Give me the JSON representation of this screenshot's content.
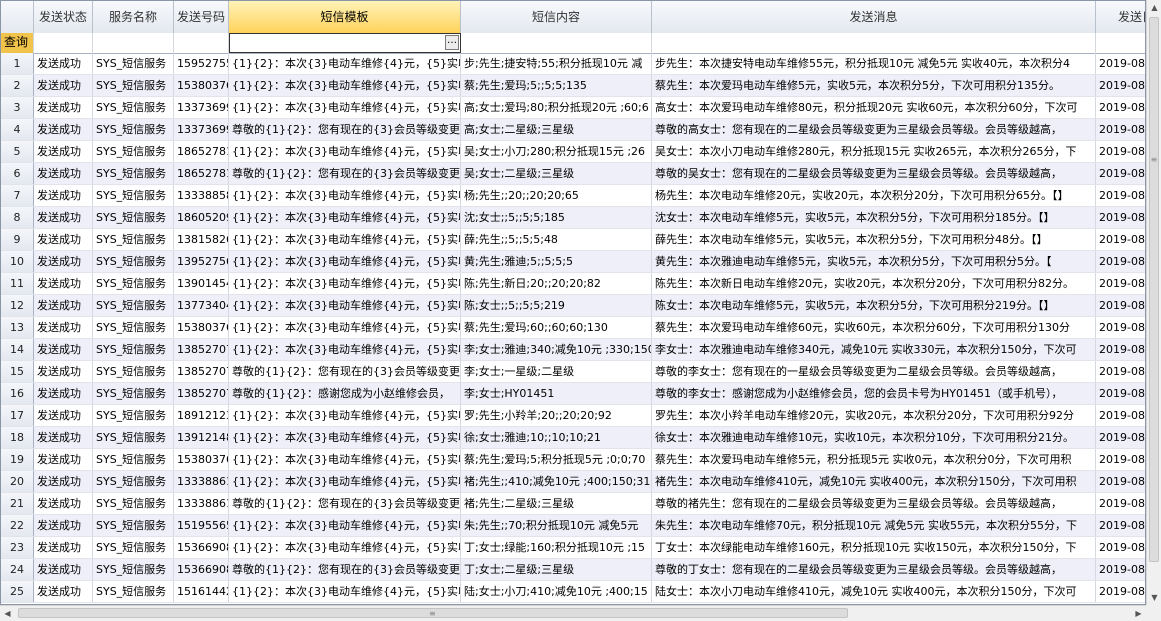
{
  "columns": [
    "发送状态",
    "服务名称",
    "发送号码",
    "短信模板",
    "短信内容",
    "发送消息",
    "发送日"
  ],
  "filter": {
    "indicator_label": "查询",
    "editor_value": "",
    "ellipsis": "…"
  },
  "scroll": {
    "vertical_arrow_up": "▲",
    "vertical_arrow_down": "▼",
    "horizontal_arrow_left": "◀",
    "horizontal_arrow_right": "▶",
    "grip": "≡"
  },
  "rows": [
    {
      "n": "1",
      "status": "发送成功",
      "service": "SYS_短信服务",
      "phone": "15952755",
      "template": "{1}{2}：本次{3}电动车维修{4}元，{5}实收{",
      "content": "步;先生;捷安特;55;积分抵现10元 减",
      "message": "步先生：本次捷安特电动车维修55元，积分抵现10元 减免5元 实收40元，本次积分4",
      "date": "2019-08"
    },
    {
      "n": "2",
      "status": "发送成功",
      "service": "SYS_短信服务",
      "phone": "15380376",
      "template": "{1}{2}：本次{3}电动车维修{4}元，{5}实收{",
      "content": "蔡;先生;爱玛;5;;5;5;135",
      "message": "蔡先生：本次爱玛电动车维修5元，实收5元，本次积分5分，下次可用积分135分。",
      "date": "2019-08"
    },
    {
      "n": "3",
      "status": "发送成功",
      "service": "SYS_短信服务",
      "phone": "13373699",
      "template": "{1}{2}：本次{3}电动车维修{4}元，{5}实收{",
      "content": "高;女士;爱玛;80;积分抵现20元 ;60;6",
      "message": "高女士：本次爱玛电动车维修80元，积分抵现20元 实收60元，本次积分60分，下次可",
      "date": "2019-08"
    },
    {
      "n": "4",
      "status": "发送成功",
      "service": "SYS_短信服务",
      "phone": "13373699",
      "template": "尊敬的{1}{2}：您有现在的{3}会员等级变更",
      "content": "高;女士;二星级;三星级",
      "message": "尊敬的高女士：您有现在的二星级会员等级变更为三星级会员等级。会员等级越高，",
      "date": "2019-08"
    },
    {
      "n": "5",
      "status": "发送成功",
      "service": "SYS_短信服务",
      "phone": "18652781",
      "template": "{1}{2}：本次{3}电动车维修{4}元，{5}实收{",
      "content": "吴;女士;小刀;280;积分抵现15元 ;26",
      "message": "吴女士：本次小刀电动车维修280元，积分抵现15元 实收265元，本次积分265分，下",
      "date": "2019-08"
    },
    {
      "n": "6",
      "status": "发送成功",
      "service": "SYS_短信服务",
      "phone": "18652781",
      "template": "尊敬的{1}{2}：您有现在的{3}会员等级变更",
      "content": "吴;女士;二星级;三星级",
      "message": "尊敬的吴女士：您有现在的二星级会员等级变更为三星级会员等级。会员等级越高，",
      "date": "2019-08"
    },
    {
      "n": "7",
      "status": "发送成功",
      "service": "SYS_短信服务",
      "phone": "13338858",
      "template": "{1}{2}：本次{3}电动车维修{4}元，{5}实收{",
      "content": "杨;先生;;20;;20;20;65",
      "message": "杨先生：本次电动车维修20元，实收20元，本次积分20分，下次可用积分65分。【】",
      "date": "2019-08"
    },
    {
      "n": "8",
      "status": "发送成功",
      "service": "SYS_短信服务",
      "phone": "18605209",
      "template": "{1}{2}：本次{3}电动车维修{4}元，{5}实收{",
      "content": "沈;女士;;5;;5;5;185",
      "message": "沈女士：本次电动车维修5元，实收5元，本次积分5分，下次可用积分185分。【】",
      "date": "2019-08"
    },
    {
      "n": "9",
      "status": "发送成功",
      "service": "SYS_短信服务",
      "phone": "13815826",
      "template": "{1}{2}：本次{3}电动车维修{4}元，{5}实收{",
      "content": "薛;先生;;5;;5;5;48",
      "message": "薛先生：本次电动车维修5元，实收5元，本次积分5分，下次可用积分48分。【】",
      "date": "2019-08"
    },
    {
      "n": "10",
      "status": "发送成功",
      "service": "SYS_短信服务",
      "phone": "13952756",
      "template": "{1}{2}：本次{3}电动车维修{4}元，{5}实收{",
      "content": "黄;先生;雅迪;5;;5;5;5",
      "message": "黄先生：本次雅迪电动车维修5元，实收5元，本次积分5分，下次可用积分5分。【",
      "date": "2019-08"
    },
    {
      "n": "11",
      "status": "发送成功",
      "service": "SYS_短信服务",
      "phone": "13901454",
      "template": "{1}{2}：本次{3}电动车维修{4}元，{5}实收{",
      "content": "陈;先生;新日;20;;20;20;82",
      "message": "陈先生：本次新日电动车维修20元，实收20元，本次积分20分，下次可用积分82分。",
      "date": "2019-08"
    },
    {
      "n": "12",
      "status": "发送成功",
      "service": "SYS_短信服务",
      "phone": "13773404",
      "template": "{1}{2}：本次{3}电动车维修{4}元，{5}实收{",
      "content": "陈;女士;;5;;5;5;219",
      "message": "陈女士：本次电动车维修5元，实收5元，本次积分5分，下次可用积分219分。【】",
      "date": "2019-08"
    },
    {
      "n": "13",
      "status": "发送成功",
      "service": "SYS_短信服务",
      "phone": "15380376",
      "template": "{1}{2}：本次{3}电动车维修{4}元，{5}实收{",
      "content": "蔡;先生;爱玛;60;;60;60;130",
      "message": "蔡先生：本次爱玛电动车维修60元，实收60元，本次积分60分，下次可用积分130分",
      "date": "2019-08"
    },
    {
      "n": "14",
      "status": "发送成功",
      "service": "SYS_短信服务",
      "phone": "13852707",
      "template": "{1}{2}：本次{3}电动车维修{4}元，{5}实收{",
      "content": "李;女士;雅迪;340;减免10元 ;330;150",
      "message": "李女士：本次雅迪电动车维修340元，减免10元 实收330元，本次积分150分，下次可",
      "date": "2019-08"
    },
    {
      "n": "15",
      "status": "发送成功",
      "service": "SYS_短信服务",
      "phone": "13852707",
      "template": "尊敬的{1}{2}：您有现在的{3}会员等级变更",
      "content": "李;女士;一星级;二星级",
      "message": "尊敬的李女士：您有现在的一星级会员等级变更为二星级会员等级。会员等级越高，",
      "date": "2019-08"
    },
    {
      "n": "16",
      "status": "发送成功",
      "service": "SYS_短信服务",
      "phone": "13852707",
      "template": "尊敬的{1}{2}：感谢您成为小赵维修会员，",
      "content": "李;女士;HY01451",
      "message": "尊敬的李女士：感谢您成为小赵维修会员，您的会员卡号为HY01451（或手机号），",
      "date": "2019-08"
    },
    {
      "n": "17",
      "status": "发送成功",
      "service": "SYS_短信服务",
      "phone": "18912123",
      "template": "{1}{2}：本次{3}电动车维修{4}元，{5}实收{",
      "content": "罗;先生;小羚羊;20;;20;20;92",
      "message": "罗先生：本次小羚羊电动车维修20元，实收20元，本次积分20分，下次可用积分92分",
      "date": "2019-08"
    },
    {
      "n": "18",
      "status": "发送成功",
      "service": "SYS_短信服务",
      "phone": "13912148",
      "template": "{1}{2}：本次{3}电动车维修{4}元，{5}实收{",
      "content": "徐;女士;雅迪;10;;10;10;21",
      "message": "徐女士：本次雅迪电动车维修10元，实收10元，本次积分10分，下次可用积分21分。",
      "date": "2019-08"
    },
    {
      "n": "19",
      "status": "发送成功",
      "service": "SYS_短信服务",
      "phone": "15380376",
      "template": "{1}{2}：本次{3}电动车维修{4}元，{5}实收{",
      "content": "蔡;先生;爱玛;5;积分抵现5元 ;0;0;70",
      "message": "蔡先生：本次爱玛电动车维修5元，积分抵现5元 实收0元，本次积分0分，下次可用积",
      "date": "2019-08"
    },
    {
      "n": "20",
      "status": "发送成功",
      "service": "SYS_短信服务",
      "phone": "13338861",
      "template": "{1}{2}：本次{3}电动车维修{4}元，{5}实收{",
      "content": "褚;先生;;410;减免10元 ;400;150;315",
      "message": "褚先生：本次电动车维修410元，减免10元 实收400元，本次积分150分，下次可用积",
      "date": "2019-08"
    },
    {
      "n": "21",
      "status": "发送成功",
      "service": "SYS_短信服务",
      "phone": "13338861",
      "template": "尊敬的{1}{2}：您有现在的{3}会员等级变更",
      "content": "褚;先生;二星级;三星级",
      "message": "尊敬的褚先生：您有现在的二星级会员等级变更为三星级会员等级。会员等级越高，",
      "date": "2019-08"
    },
    {
      "n": "22",
      "status": "发送成功",
      "service": "SYS_短信服务",
      "phone": "15195565",
      "template": "{1}{2}：本次{3}电动车维修{4}元，{5}实收{",
      "content": "朱;先生;;70;积分抵现10元 减免5元",
      "message": "朱先生：本次电动车维修70元，积分抵现10元 减免5元 实收55元，本次积分55分，下",
      "date": "2019-08"
    },
    {
      "n": "23",
      "status": "发送成功",
      "service": "SYS_短信服务",
      "phone": "15366908",
      "template": "{1}{2}：本次{3}电动车维修{4}元，{5}实收{",
      "content": "丁;女士;绿能;160;积分抵现10元 ;15",
      "message": "丁女士：本次绿能电动车维修160元，积分抵现10元 实收150元，本次积分150分，下",
      "date": "2019-08"
    },
    {
      "n": "24",
      "status": "发送成功",
      "service": "SYS_短信服务",
      "phone": "15366908",
      "template": "尊敬的{1}{2}：您有现在的{3}会员等级变更",
      "content": "丁;女士;二星级;三星级",
      "message": "尊敬的丁女士：您有现在的二星级会员等级变更为三星级会员等级。会员等级越高，",
      "date": "2019-08"
    },
    {
      "n": "25",
      "status": "发送成功",
      "service": "SYS_短信服务",
      "phone": "15161442",
      "template": "{1}{2}：本次{3}电动车维修{4}元，{5}实收{",
      "content": "陆;女士;小刀;410;减免10元 ;400;15",
      "message": "陆女士：本次小刀电动车维修410元，减免10元 实收400元，本次积分150分，下次可",
      "date": "2019-08"
    }
  ]
}
